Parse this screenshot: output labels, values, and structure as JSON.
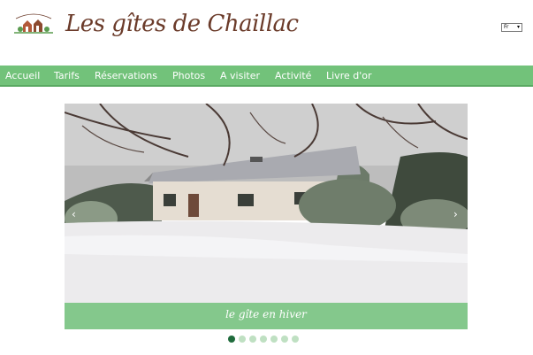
{
  "header": {
    "logo_icon": "house-logo-icon",
    "site_title": "Les gîtes de Chaillac",
    "language": {
      "selected": "Fr"
    }
  },
  "nav": {
    "items": [
      {
        "label": "Accueil"
      },
      {
        "label": "Tarifs"
      },
      {
        "label": "Réservations"
      },
      {
        "label": "Photos"
      },
      {
        "label": "A visiter"
      },
      {
        "label": "Activité"
      },
      {
        "label": "Livre d'or"
      }
    ],
    "color": "#72c27a"
  },
  "carousel": {
    "caption": "le gîte en hiver",
    "prev_icon": "chevron-left-icon",
    "next_icon": "chevron-right-icon",
    "slide_count": 7,
    "active_slide": 1,
    "active_color": "#1f6b3c"
  }
}
